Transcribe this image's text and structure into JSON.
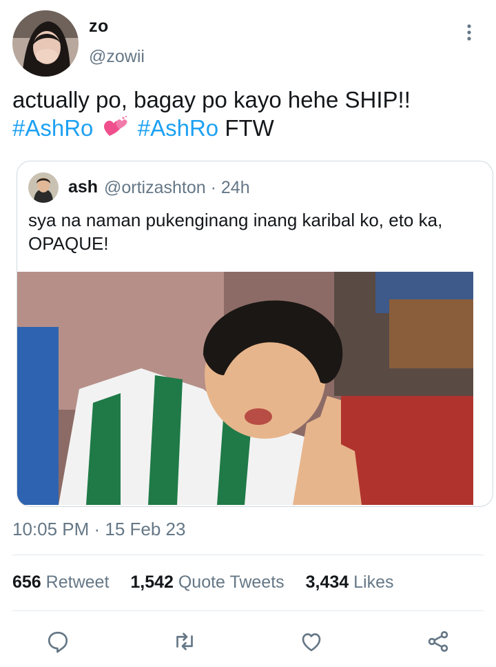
{
  "author": {
    "display_name": "zo",
    "handle": "@zowii"
  },
  "tweet": {
    "text_prefix": "actually po, bagay po kayo hehe SHIP!!",
    "hashtag_1": "#AshRo",
    "hashtag_2": "#AshRo",
    "text_suffix": "FTW"
  },
  "quoted_tweet": {
    "display_name": "ash",
    "handle": "@ortizashton",
    "time_ago": "· 24h",
    "text": "sya na naman pukenginang inang karibal ko, eto ka, OPAQUE!"
  },
  "timestamp": "10:05 PM · 15 Feb 23",
  "stats": {
    "retweets": {
      "count": "656",
      "label": "Retweet"
    },
    "quotes": {
      "count": "1,542",
      "label": "Quote Tweets"
    },
    "likes": {
      "count": "3,434",
      "label": "Likes"
    }
  },
  "colors": {
    "link": "#1da1f2",
    "secondary": "#657786",
    "divider": "#e1e8ed"
  },
  "icons": [
    "more-vertical-icon",
    "reply-icon",
    "retweet-icon",
    "like-icon",
    "share-icon",
    "two-hearts-emoji"
  ]
}
